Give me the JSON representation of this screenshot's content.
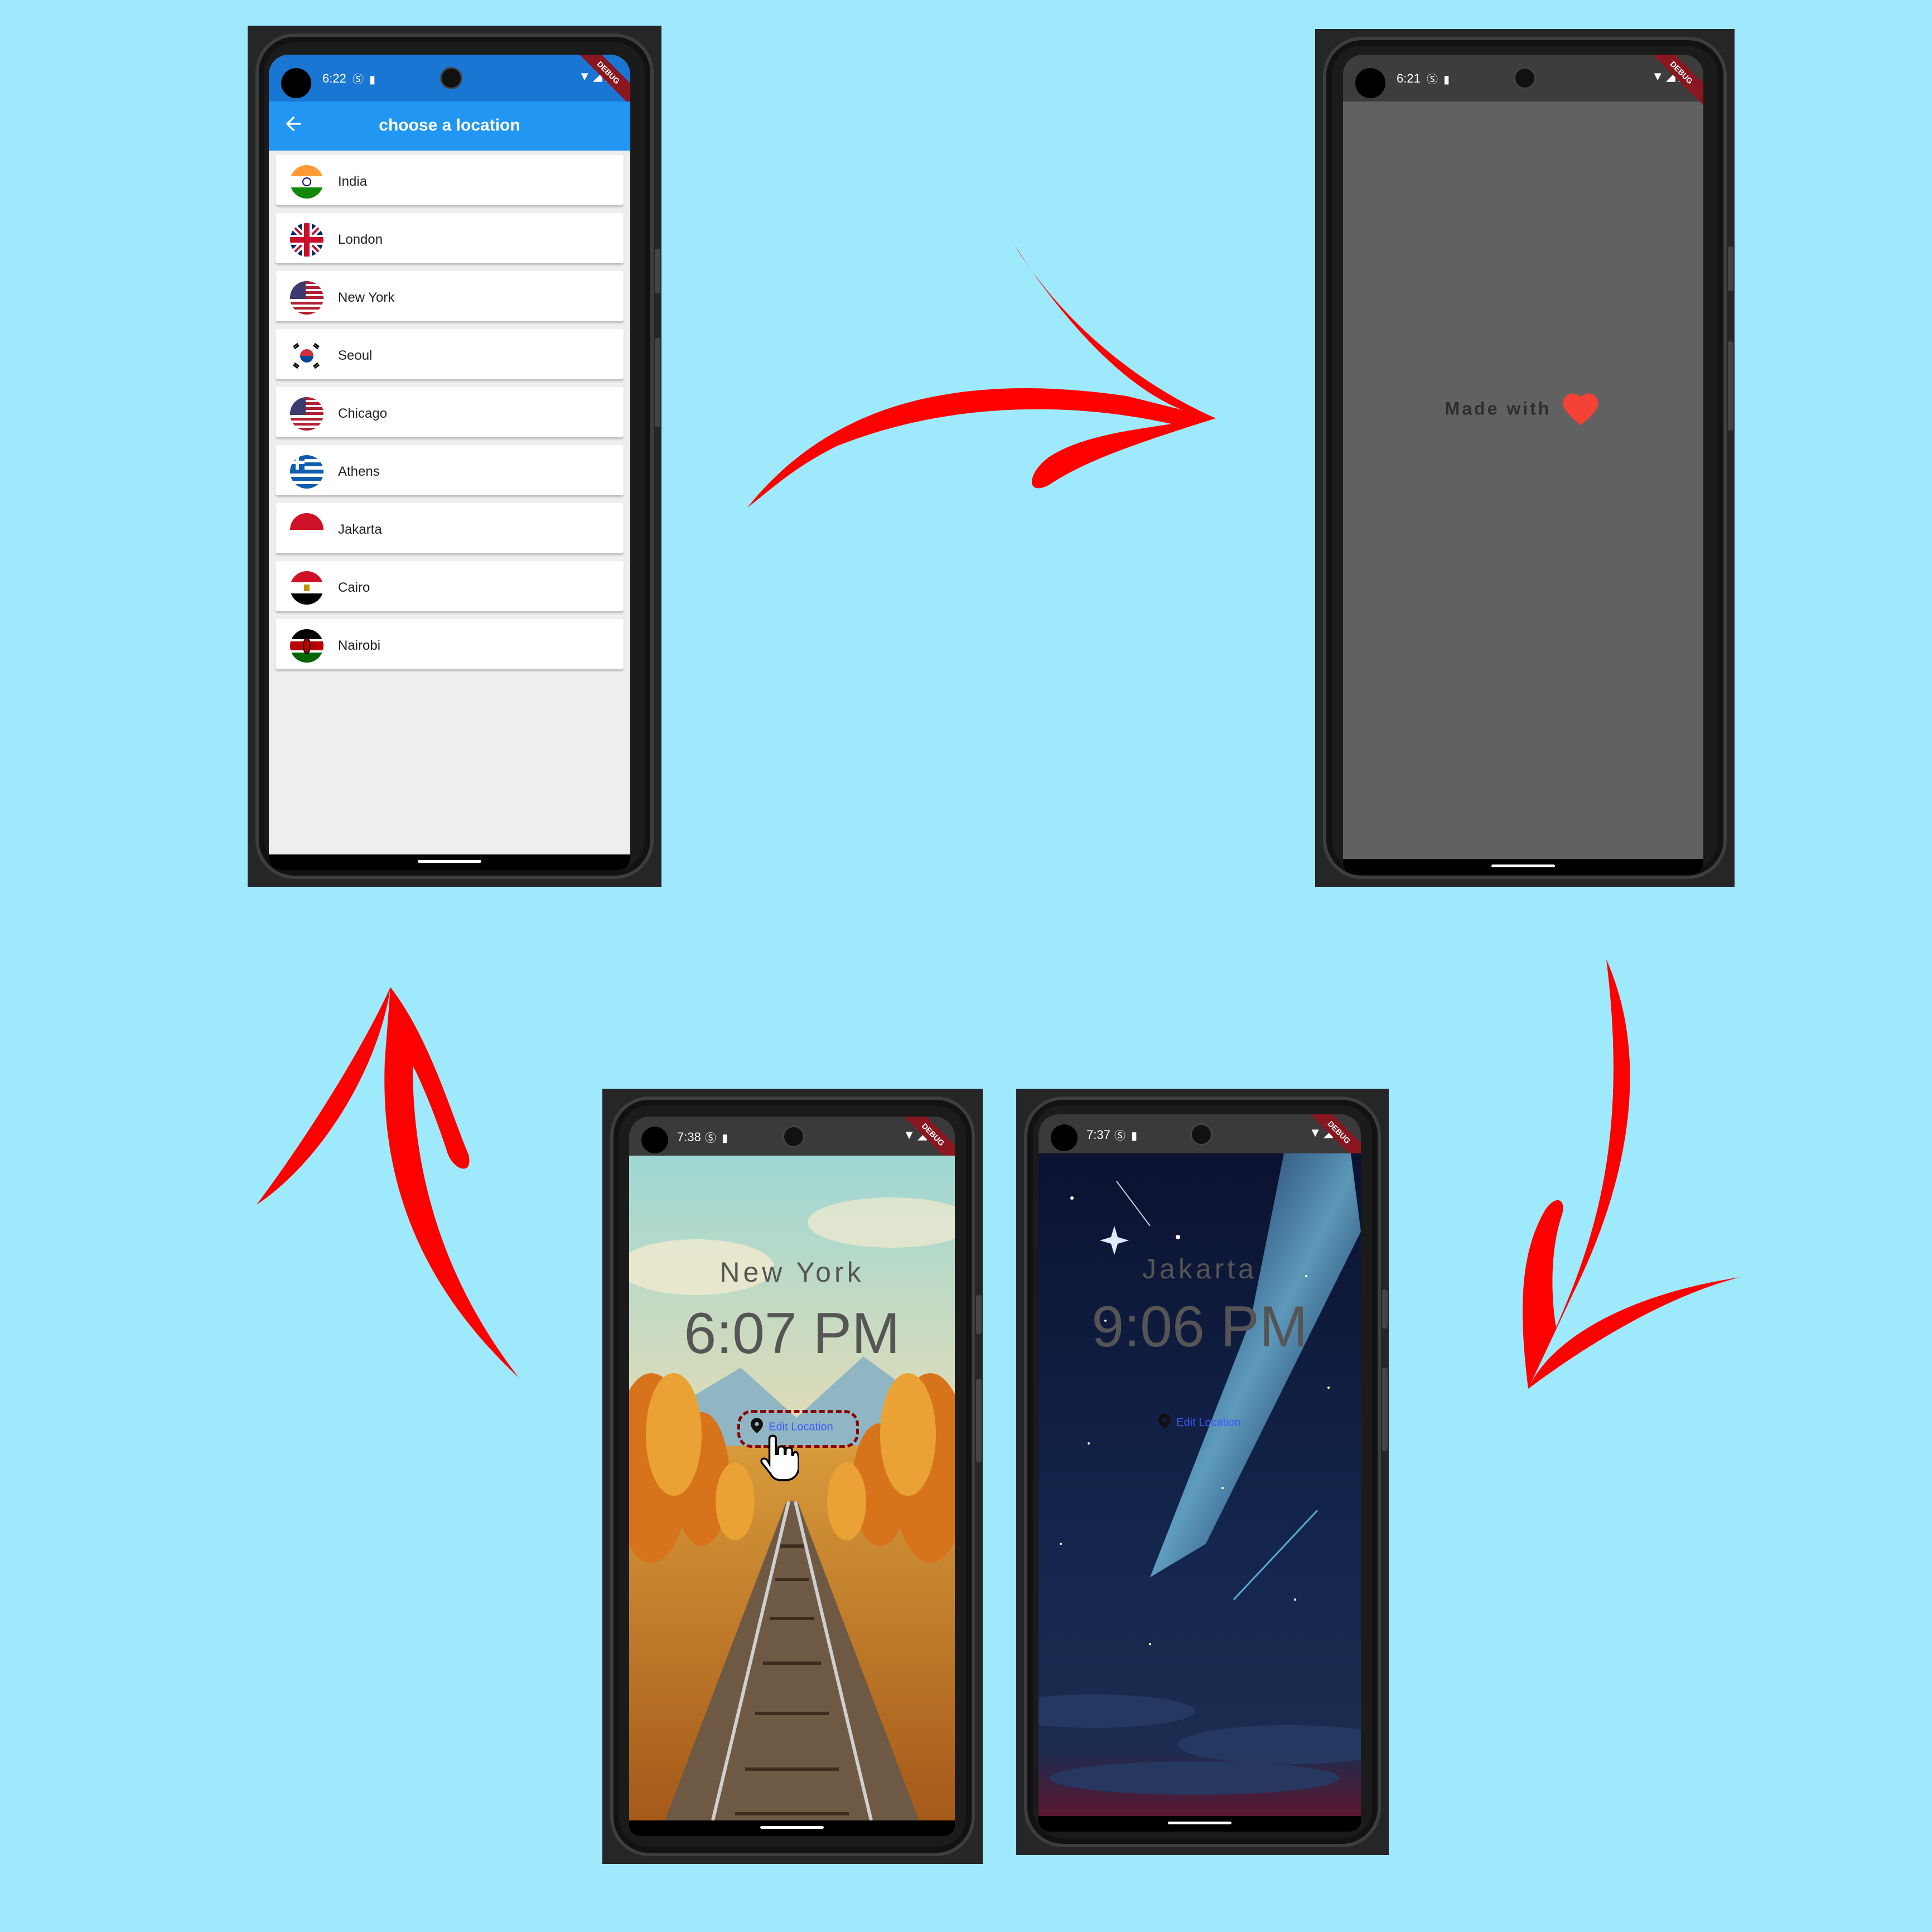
{
  "colors": {
    "background": "#9eeafc",
    "arrow": "#ff0000",
    "appbar": "#2196f3",
    "splash": "#616161"
  },
  "phone_location": {
    "status_time": "6:22",
    "appbar_title": "choose a location",
    "back_icon": "arrow-left-icon",
    "locations": [
      {
        "name": "India",
        "flag": "india"
      },
      {
        "name": "London",
        "flag": "uk"
      },
      {
        "name": "New York",
        "flag": "usa"
      },
      {
        "name": "Seoul",
        "flag": "korea"
      },
      {
        "name": "Chicago",
        "flag": "usa"
      },
      {
        "name": "Athens",
        "flag": "greece"
      },
      {
        "name": "Jakarta",
        "flag": "indonesia"
      },
      {
        "name": "Cairo",
        "flag": "egypt"
      },
      {
        "name": "Nairobi",
        "flag": "kenya"
      }
    ]
  },
  "phone_splash": {
    "status_time": "6:21",
    "made_with": "Made with",
    "heart_icon": "heart-icon"
  },
  "phone_newyork": {
    "status_time": "7:38",
    "city": "New York",
    "time": "6:07 PM",
    "edit_label": "Edit Location"
  },
  "phone_jakarta": {
    "status_time": "7:37",
    "city": "Jakarta",
    "time": "9:06 PM",
    "edit_label": "Edit Location"
  },
  "debug_label": "DEBUG"
}
